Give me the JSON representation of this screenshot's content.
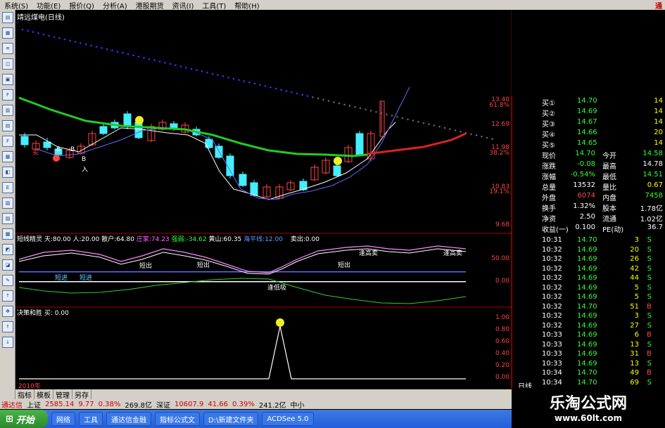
{
  "menubar": {
    "items": [
      "系统(S)",
      "功能(E)",
      "报价(Q)",
      "分析(A)",
      "港股期货",
      "资讯(I)",
      "工具(T)",
      "帮助(H)"
    ],
    "brand": "通"
  },
  "stock_title": "靖远煤电(日线)",
  "main_chart": {
    "price_labels": [
      "13.40",
      "61.8%",
      "12.69",
      "11.98",
      "38.2%",
      "10.83",
      "19.1%",
      "9.68"
    ],
    "annotations": [
      "买",
      "B",
      "B",
      "B",
      "入"
    ]
  },
  "indicator1": {
    "header": [
      {
        "text": "短线精灵  天:80.00  人:20.00  散户:64.80",
        "color": "#ffffff"
      },
      {
        "text": "庄家:74.23",
        "color": "#ff66ff"
      },
      {
        "text": "强弱:-34.62",
        "color": "#33ff33"
      },
      {
        "text": "黄山:60.35",
        "color": "#ffffff"
      },
      {
        "text": "海平线:12.00",
        "color": "#6699ff"
      },
      {
        "text": "卖出:0.00",
        "color": "#ffffff"
      }
    ],
    "axis": [
      "50.00",
      "0.00"
    ],
    "labels": [
      "短出",
      "短出",
      "短出",
      "短进",
      "短进",
      "逢高卖",
      "逢高卖",
      "逢低吸"
    ]
  },
  "indicator2": {
    "header": "决策和胜 买: 0.00",
    "axis": [
      "1.00",
      "0.80",
      "0.60",
      "0.40",
      "0.20",
      "0.00"
    ],
    "year": "2010年"
  },
  "quote_panel": {
    "buy_levels": [
      {
        "label": "买①",
        "price": "14.70",
        "vol": "14"
      },
      {
        "label": "买②",
        "price": "14.69",
        "vol": "14"
      },
      {
        "label": "买③",
        "price": "14.67",
        "vol": "14"
      },
      {
        "label": "买④",
        "price": "14.66",
        "vol": "20"
      },
      {
        "label": "买⑤",
        "price": "14.65",
        "vol": "14"
      }
    ],
    "stats": [
      {
        "l1": "现价",
        "v1": "14.70",
        "c1": "grn",
        "l2": "今开",
        "v2": "14.58",
        "c2": "grn"
      },
      {
        "l1": "涨跌",
        "v1": "-0.08",
        "c1": "grn",
        "l2": "最高",
        "v2": "14.78",
        "c2": "wht"
      },
      {
        "l1": "涨幅",
        "v1": "-0.54%",
        "c1": "grn",
        "l2": "最低",
        "v2": "14.51",
        "c2": "grn"
      },
      {
        "l1": "总量",
        "v1": "13532",
        "c1": "wht",
        "l2": "量比",
        "v2": "0.67",
        "c2": "yel"
      },
      {
        "l1": "外盘",
        "v1": "6074",
        "c1": "red",
        "l2": "内盘",
        "v2": "7458",
        "c2": "grn"
      },
      {
        "l1": "换手",
        "v1": "1.32%",
        "c1": "wht",
        "l2": "股本",
        "v2": "1.78亿",
        "c2": "wht"
      },
      {
        "l1": "净资",
        "v1": "2.50",
        "c1": "wht",
        "l2": "流通",
        "v2": "1.02亿",
        "c2": "wht"
      },
      {
        "l1": "收益(一)",
        "v1": "0.100",
        "c1": "wht",
        "l2": "PE(动)",
        "v2": "36.7",
        "c2": "wht"
      }
    ],
    "ticks": [
      {
        "time": "10:31",
        "price": "14.70",
        "vol": "3",
        "side": "S"
      },
      {
        "time": "10:32",
        "price": "14.69",
        "vol": "20",
        "side": "S"
      },
      {
        "time": "10:32",
        "price": "14.69",
        "vol": "26",
        "side": "S"
      },
      {
        "time": "10:32",
        "price": "14.69",
        "vol": "42",
        "side": "S"
      },
      {
        "time": "10:32",
        "price": "14.69",
        "vol": "44",
        "side": "S"
      },
      {
        "time": "10:32",
        "price": "14.69",
        "vol": "5",
        "side": "S"
      },
      {
        "time": "10:32",
        "price": "14.69",
        "vol": "5",
        "side": "S"
      },
      {
        "time": "10:32",
        "price": "14.70",
        "vol": "51",
        "side": "B"
      },
      {
        "time": "10:32",
        "price": "14.69",
        "vol": "3",
        "side": "S"
      },
      {
        "time": "10:32",
        "price": "14.69",
        "vol": "27",
        "side": "S"
      },
      {
        "time": "10:33",
        "price": "14.69",
        "vol": "6",
        "side": "B"
      },
      {
        "time": "10:33",
        "price": "14.69",
        "vol": "13",
        "side": "S"
      },
      {
        "time": "10:33",
        "price": "14.69",
        "vol": "31",
        "side": "B"
      },
      {
        "time": "10:33",
        "price": "14.69",
        "vol": "13",
        "side": "S"
      },
      {
        "time": "10:34",
        "price": "14.70",
        "vol": "49",
        "side": "B"
      },
      {
        "time": "10:34",
        "price": "14.70",
        "vol": "69",
        "side": "S"
      }
    ],
    "footer": "日线"
  },
  "bottom_tabs": [
    "指标",
    "模板",
    "管理",
    "另存"
  ],
  "status_bar": {
    "items": [
      {
        "t": "通达信",
        "c": "#c00"
      },
      {
        "t": "上证",
        "c": "#000"
      },
      {
        "t": "2585.14",
        "c": "#c00"
      },
      {
        "t": "9.77",
        "c": "#c00"
      },
      {
        "t": "0.38%",
        "c": "#c00"
      },
      {
        "t": "269.8亿",
        "c": "#000"
      },
      {
        "t": "深证",
        "c": "#000"
      },
      {
        "t": "10607.9",
        "c": "#c00"
      },
      {
        "t": "41.66",
        "c": "#c00"
      },
      {
        "t": "0.39%",
        "c": "#c00"
      },
      {
        "t": "241.2亿",
        "c": "#000"
      },
      {
        "t": "中小",
        "c": "#000"
      }
    ]
  },
  "taskbar": {
    "start": "开始",
    "tasks": [
      "网络",
      "工具",
      "通达信金融",
      "指标公式文",
      "D:\\新建文件夹",
      "ACDSee 5.0"
    ]
  },
  "watermark": {
    "line1": "乐淘公式网",
    "line2": "www.60lt.com"
  }
}
